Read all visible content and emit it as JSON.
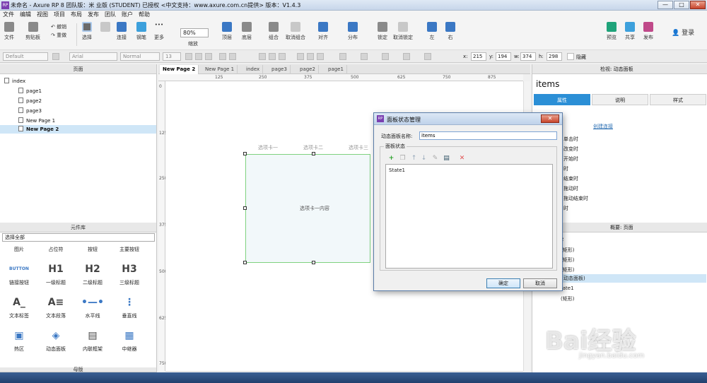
{
  "window": {
    "title": "未命名 - Axure RP 8 团队版：米 业版 (STUDENT) 已授权 <中文支持：www.axure.com.cn提供> 版本：V1.4.3",
    "minimize": "—",
    "maximize": "□",
    "close": "✕"
  },
  "menu": [
    "文件",
    "编辑",
    "视图",
    "项目",
    "布局",
    "发布",
    "团队",
    "账户",
    "帮助"
  ],
  "toolbar": {
    "file": "文件",
    "clipboard": "剪贴板",
    "undo": "撤销",
    "redo": "重做",
    "select": "选择",
    "connect": "连接",
    "pen": "钢笔",
    "more": "更多",
    "zoom_value": "80%",
    "zoom_label": "缩放",
    "top": "顶层",
    "bottom": "底层",
    "group": "组合",
    "ungroup": "取消组合",
    "align": "对齐",
    "distribute": "分布",
    "lock": "锁定",
    "unlock": "取消锁定",
    "left": "左",
    "right": "右",
    "preview": "预览",
    "share": "共享",
    "publish": "发布",
    "login": "登录"
  },
  "format": {
    "style": "Default",
    "font": "Arial",
    "weight": "Normal",
    "size": "13",
    "x_label": "x:",
    "x": "215",
    "y_label": "y:",
    "y": "194",
    "w_label": "w:",
    "w": "374",
    "h_label": "h:",
    "h": "298",
    "hidden": "隐藏"
  },
  "pages_panel": {
    "title": "页面",
    "items": [
      {
        "label": "index",
        "level": 0
      },
      {
        "label": "page1",
        "level": 1
      },
      {
        "label": "page2",
        "level": 1
      },
      {
        "label": "page3",
        "level": 1
      },
      {
        "label": "New Page 1",
        "level": 1
      },
      {
        "label": "New Page 2",
        "level": 1,
        "selected": true
      }
    ]
  },
  "library": {
    "title": "元件库",
    "select_value": "选择全部",
    "row0": [
      "图片",
      "占位符",
      "按钮",
      "主要按钮"
    ],
    "widgets": [
      {
        "icon": "BUTTON",
        "label": "链接按钮"
      },
      {
        "icon": "H1",
        "label": "一级标题"
      },
      {
        "icon": "H2",
        "label": "二级标题"
      },
      {
        "icon": "H3",
        "label": "三级标题"
      },
      {
        "icon": "A_",
        "label": "文本标签"
      },
      {
        "icon": "A≡",
        "label": "文本段落"
      },
      {
        "icon": "•—•",
        "label": "水平线"
      },
      {
        "icon": "⋮",
        "label": "垂直线"
      },
      {
        "icon": "▣",
        "label": "热区"
      },
      {
        "icon": "◈",
        "label": "动态面板"
      },
      {
        "icon": "▤",
        "label": "内联框架"
      },
      {
        "icon": "▦",
        "label": "中继器"
      }
    ],
    "masters": "母版"
  },
  "tabs": [
    "New Page 2",
    "New Page 1",
    "index",
    "page3",
    "page2",
    "page1"
  ],
  "ruler_top": [
    "125",
    "250",
    "375",
    "500",
    "625",
    "750",
    "875"
  ],
  "ruler_left": [
    "0",
    "125",
    "250",
    "375",
    "500",
    "625",
    "750"
  ],
  "canvas": {
    "tab_headers": [
      "选项卡一",
      "选项卡二",
      "选项卡三"
    ],
    "panel_content": "选项卡一内容"
  },
  "inspector": {
    "title": "检视: 动态面板",
    "name": "items",
    "tabs": [
      "属性",
      "说明",
      "样式"
    ],
    "create_link": "创建连接",
    "events": [
      "单击时",
      "改变时",
      "开始时",
      "时",
      "结束时",
      "拖动时",
      "拖动结束时",
      "时"
    ]
  },
  "outline": {
    "title": "概要: 页面",
    "rows": [
      {
        "label": "2"
      },
      {
        "label": "(矩形)"
      },
      {
        "label": "(矩形)"
      },
      {
        "label": "(矩形)"
      },
      {
        "label": "动态面板)",
        "selected": true
      },
      {
        "label": "tate1"
      },
      {
        "label": "(矩形)"
      }
    ]
  },
  "dialog": {
    "title": "面板状态管理",
    "name_label": "动态面板名称:",
    "name_value": "items",
    "group_label": "面板状态",
    "states": [
      "State1"
    ],
    "ok": "确定",
    "cancel": "取消"
  },
  "watermark": {
    "text": "Bai经验",
    "sub": "jingyan.baidu.com"
  }
}
